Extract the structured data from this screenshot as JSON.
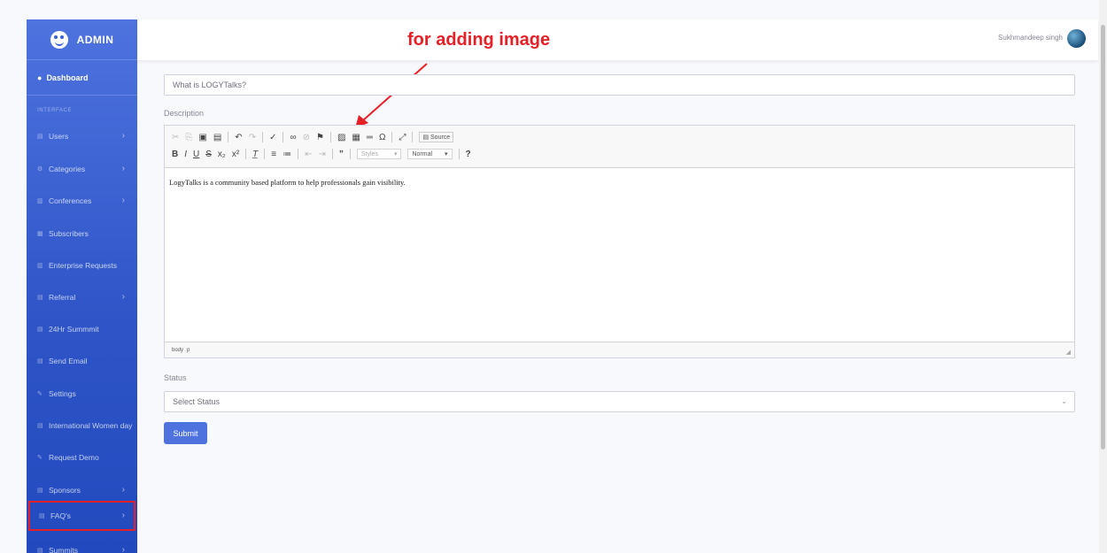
{
  "annotation": {
    "text": "for adding image",
    "color": "#e52026"
  },
  "brand": {
    "title": "ADMIN",
    "accent": "#4e73df"
  },
  "sidebar": {
    "dashboard": "Dashboard",
    "section_heading": "INTERFACE",
    "items": [
      {
        "label": "Users",
        "icon": "table-icon",
        "chevron": true
      },
      {
        "label": "Categories",
        "icon": "gear-icon",
        "chevron": true
      },
      {
        "label": "Conferences",
        "icon": "chart-icon",
        "chevron": true
      },
      {
        "label": "Subscribers",
        "icon": "grid-icon",
        "chevron": false
      },
      {
        "label": "Enterprise Requests",
        "icon": "chart-icon",
        "chevron": false
      },
      {
        "label": "Referral",
        "icon": "table-icon",
        "chevron": true
      },
      {
        "label": "24Hr Summmit",
        "icon": "table-icon",
        "chevron": false
      },
      {
        "label": "Send Email",
        "icon": "table-icon",
        "chevron": false
      },
      {
        "label": "Settings",
        "icon": "wrench-icon",
        "chevron": false
      },
      {
        "label": "International Women day",
        "icon": "table-icon",
        "chevron": false
      },
      {
        "label": "Request Demo",
        "icon": "wrench-icon",
        "chevron": false
      },
      {
        "label": "Sponsors",
        "icon": "table-icon",
        "chevron": true
      },
      {
        "label": "FAQ's",
        "icon": "table-icon",
        "chevron": true,
        "highlighted": true
      },
      {
        "label": "Summits",
        "icon": "table-icon",
        "chevron": true
      }
    ]
  },
  "topbar": {
    "user_name": "Sukhmandeep singh"
  },
  "form": {
    "question_value": "What is LOGYTalks?",
    "description_label": "Description",
    "editor": {
      "toolbar_row1": [
        "cut-icon",
        "copy-icon",
        "paste-icon",
        "paste-text-icon",
        "paste-word-icon",
        "undo-icon",
        "redo-icon",
        "spellcheck-icon",
        "link-icon",
        "unlink-icon",
        "anchor-icon",
        "image-icon",
        "table-icon",
        "horizontal-line-icon",
        "special-char-icon",
        "maximize-icon"
      ],
      "source_label": "Source",
      "toolbar_row2": [
        "bold-icon",
        "italic-icon",
        "underline-icon",
        "strike-icon",
        "subscript-icon",
        "superscript-icon",
        "remove-format-icon",
        "numbered-list-icon",
        "bulleted-list-icon",
        "outdent-icon",
        "indent-icon",
        "blockquote-icon"
      ],
      "styles_placeholder": "Styles",
      "format_value": "Normal",
      "help_label": "?",
      "content": "LogyTalks is a community based platform to help professionals gain visibility.",
      "path": [
        "body",
        "p"
      ]
    },
    "status_label": "Status",
    "status_placeholder": "Select Status",
    "submit_label": "Submit"
  }
}
